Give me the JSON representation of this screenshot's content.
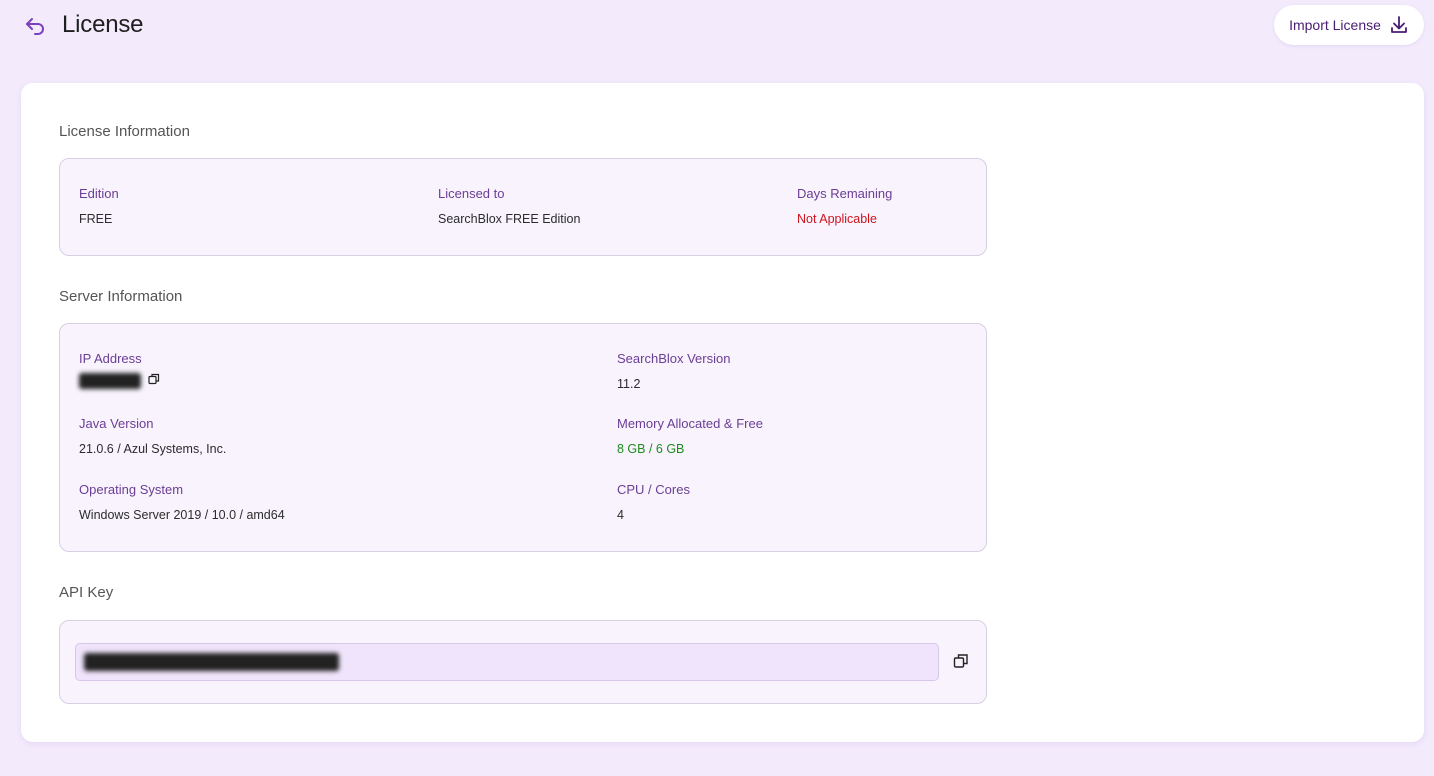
{
  "header": {
    "title": "License",
    "import_label": "Import License"
  },
  "license_info": {
    "section_title": "License Information",
    "edition_label": "Edition",
    "edition_value": "FREE",
    "licensed_to_label": "Licensed to",
    "licensed_to_value": "SearchBlox FREE Edition",
    "days_remaining_label": "Days Remaining",
    "days_remaining_value": "Not Applicable"
  },
  "server_info": {
    "section_title": "Server Information",
    "ip_label": "IP Address",
    "searchblox_version_label": "SearchBlox Version",
    "searchblox_version_value": "11.2",
    "java_label": "Java Version",
    "java_value": "21.0.6 / Azul Systems, Inc.",
    "memory_label": "Memory Allocated & Free",
    "memory_value": "8 GB / 6 GB",
    "os_label": "Operating System",
    "os_value": "Windows Server 2019 / 10.0 / amd64",
    "cpu_label": "CPU / Cores",
    "cpu_value": "4"
  },
  "api_key": {
    "section_title": "API Key"
  },
  "icons": {
    "back": "back-arrow-icon",
    "import": "download-icon",
    "copy": "copy-icon"
  },
  "colors": {
    "background": "#f3eafc",
    "label": "#6b3e95",
    "accent": "#4a1c73",
    "not_applicable": "#d0141c",
    "memory": "#1f8a1f"
  }
}
